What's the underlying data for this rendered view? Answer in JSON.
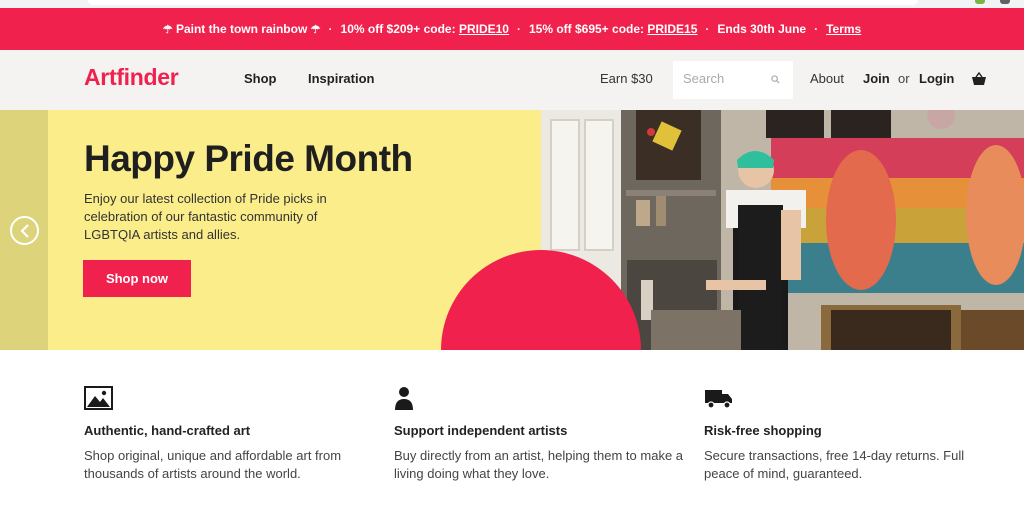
{
  "promo": {
    "rainbow_text": "Paint the town rainbow",
    "offer1_prefix": "10% off $209+ code:",
    "offer1_code": "PRIDE10",
    "offer2_prefix": "15% off $695+ code:",
    "offer2_code": "PRIDE15",
    "ends": "Ends 30th June",
    "terms": "Terms",
    "separator": "·"
  },
  "nav": {
    "logo": "Artfinder",
    "links": [
      "Shop",
      "Inspiration"
    ],
    "earn": "Earn $30",
    "search_placeholder": "Search",
    "about": "About",
    "join": "Join",
    "or": "or",
    "login": "Login"
  },
  "hero": {
    "title": "Happy Pride Month",
    "description": "Enjoy our latest collection of Pride picks in celebration of our fantastic community of LGBTQIA artists and allies.",
    "cta": "Shop now"
  },
  "features": [
    {
      "icon": "image-icon",
      "title": "Authentic, hand-crafted art",
      "text": "Shop original, unique and affordable art from thousands of artists around the world."
    },
    {
      "icon": "person-icon",
      "title": "Support independent artists",
      "text": "Buy directly from an artist, helping them to make a living doing what they love."
    },
    {
      "icon": "truck-icon",
      "title": "Risk-free shopping",
      "text": "Secure transactions, free 14-day returns. Full peace of mind, guaranteed."
    }
  ],
  "colors": {
    "brand": "#f0214d",
    "hero_bg": "#fbed8a",
    "nav_bg": "#f4f3f1"
  }
}
